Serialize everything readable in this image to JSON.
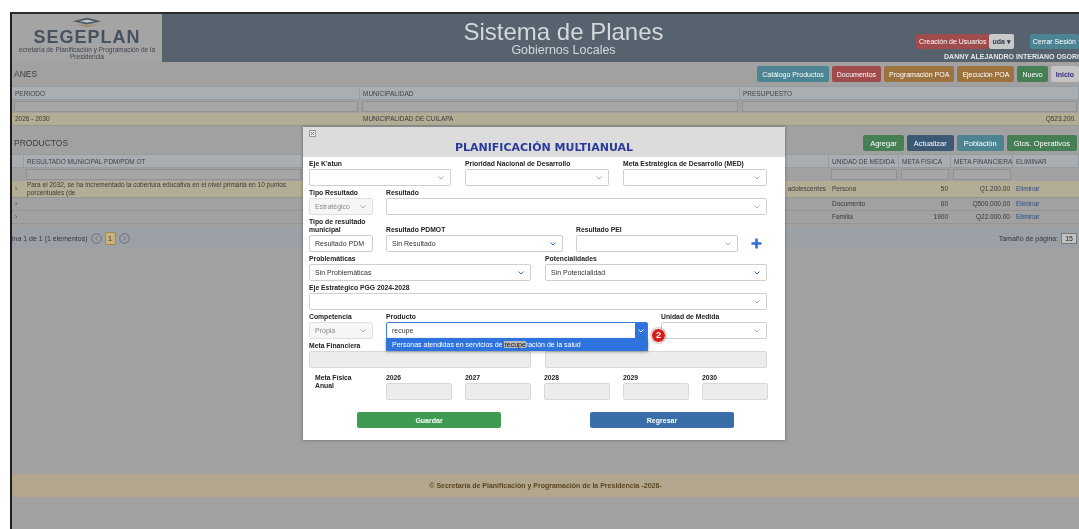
{
  "header": {
    "logo_text": "SEGEPLAN",
    "logo_subtitle": "ecretaría de Planificación y Programación de la Presidencia",
    "title": "Sistema de Planes",
    "subtitle": "Gobiernos Locales",
    "create_users": {
      "label": "Creación de Usuarios"
    },
    "help_menu": {
      "label": "uda",
      "caret": "▾"
    },
    "logout": {
      "label": "Cerrar Sesión"
    },
    "user": "DANNY ALEJANDRO INTERIANO OSORI"
  },
  "plans": {
    "title": "ANES",
    "actions": [
      {
        "label": "Catálogo Productos",
        "kind": "info"
      },
      {
        "label": "Documentos",
        "kind": "danger"
      },
      {
        "label": "Programación POA",
        "kind": "warning"
      },
      {
        "label": "Ejecución POA",
        "kind": "warning"
      },
      {
        "label": "Nuevo",
        "kind": "success"
      },
      {
        "label": "Inicio",
        "kind": "default"
      }
    ],
    "columns": [
      "PERIODO",
      "MUNICIPALIDAD",
      "PRESUPUESTO"
    ],
    "rows": [
      [
        "2026 - 2030",
        "MUNICIPALIDAD DE CUILAPA",
        "Q523.200."
      ]
    ]
  },
  "products": {
    "title": "PRODUCTOS",
    "actions": [
      {
        "label": "Agregar",
        "kind": "success"
      },
      {
        "label": "Actualizar",
        "kind": "primary"
      },
      {
        "label": "Población",
        "kind": "info"
      },
      {
        "label": "Gtos. Operativos",
        "kind": "success"
      }
    ],
    "columns": {
      "result": "RESULTADO MUNICIPAL PDM/PDM OT",
      "unit": "UNIDAD DE MEDIDA",
      "physical_goal": "META FISICA",
      "financial_goal": "META FINANCIERA",
      "action": "ELIMINAR"
    },
    "rows": [
      {
        "expander": "›",
        "result": "Para el 2032, se ha incrementado la cobertura educativa en el nivel primaria en 10 puntos porcentuales (de",
        "column_3": "adolescentes",
        "unit": "Persona",
        "physical_goal": "50",
        "financial_goal": "Q1.200.00",
        "action": "Eliminar",
        "selected": true
      },
      {
        "expander": "›",
        "unit": "Documento",
        "physical_goal": "60",
        "financial_goal": "Q500.000.00",
        "action": "Eliminar",
        "selected": false
      },
      {
        "expander": "›",
        "unit": "Familia",
        "physical_goal": "1900",
        "financial_goal": "Q22.000.00",
        "action": "Eliminar",
        "selected": false
      }
    ],
    "pager": {
      "summary": "ina 1 de 1 (1 elementos)",
      "pages": [
        {
          "label": "1",
          "selected": true
        }
      ],
      "page_size_label": "Tamaño de página:",
      "page_size": "15"
    }
  },
  "modal": {
    "title": "PLANIFICACIÓN MULTIANUAL",
    "rows": [
      [
        {
          "kind": "select",
          "label": "Eje K'atun",
          "disabled": false
        },
        {
          "kind": "select",
          "label": "Prioridad Nacional de Desarrollo",
          "disabled": false
        },
        {
          "kind": "select",
          "label": "Meta Estratégica de Desarrollo (MED)",
          "disabled": false
        }
      ],
      [
        {
          "kind": "select",
          "label": "Tipo Resultado",
          "value": "Estratégico",
          "disabled": true
        },
        {
          "kind": "select",
          "label": "Resultado",
          "disabled": false
        }
      ],
      [
        {
          "kind": "select",
          "label": "Tipo de resultado municipal",
          "value": "Resultado PDM",
          "disabled": false
        },
        {
          "kind": "select",
          "label": "Resultado PDMOT",
          "value": "Sin Resultado",
          "disabled": false
        },
        {
          "kind": "select",
          "label": "Resultado PEI",
          "disabled": false
        },
        {
          "kind": "add"
        }
      ],
      [
        {
          "kind": "select",
          "label": "Problemáticas",
          "value": "Sin Problemáticas",
          "disabled": false
        },
        {
          "kind": "select",
          "label": "Potencialidades",
          "value": "Sin Potencialidad",
          "disabled": false
        }
      ],
      [
        {
          "kind": "select",
          "label": "Eje Estratégico PGG 2024-2028",
          "disabled": false
        }
      ],
      [
        {
          "kind": "select",
          "label": "Competencia",
          "value": "Propia",
          "disabled": true
        },
        {
          "kind": "combo",
          "label": "Producto",
          "value": "recupe",
          "disabled": false,
          "expanded": true,
          "options": [
            {
              "parts": [
                {
                  "text": "Personas atendidas en servicios de ",
                  "highlighted": false
                },
                {
                  "text": "recupe",
                  "highlighted": true
                },
                {
                  "text": "ración de la salud",
                  "highlighted": false
                }
              ],
              "selected": true
            }
          ]
        },
        {
          "kind": "select",
          "label": "Unidad de Medida",
          "disabled": false
        }
      ],
      [
        {
          "kind": "input",
          "label": "Meta Financiera",
          "disabled": true
        },
        {
          "kind": "input",
          "disabled": true
        }
      ],
      [
        {
          "kind": "caption",
          "label": "Meta Física Anual"
        },
        {
          "kind": "input",
          "label": "2026",
          "disabled": true
        },
        {
          "kind": "input",
          "label": "2027",
          "disabled": true
        },
        {
          "kind": "input",
          "label": "2028",
          "disabled": true
        },
        {
          "kind": "input",
          "label": "2029",
          "disabled": true
        },
        {
          "kind": "input",
          "label": "2030",
          "disabled": true
        }
      ]
    ],
    "buttons": [
      {
        "label": "Guardar",
        "kind": "success"
      },
      {
        "label": "Regresar",
        "kind": "primary"
      }
    ]
  },
  "step_badge": "2",
  "footer": "© Secretaría de Planificación y Programación de la Presidencia -2026-"
}
